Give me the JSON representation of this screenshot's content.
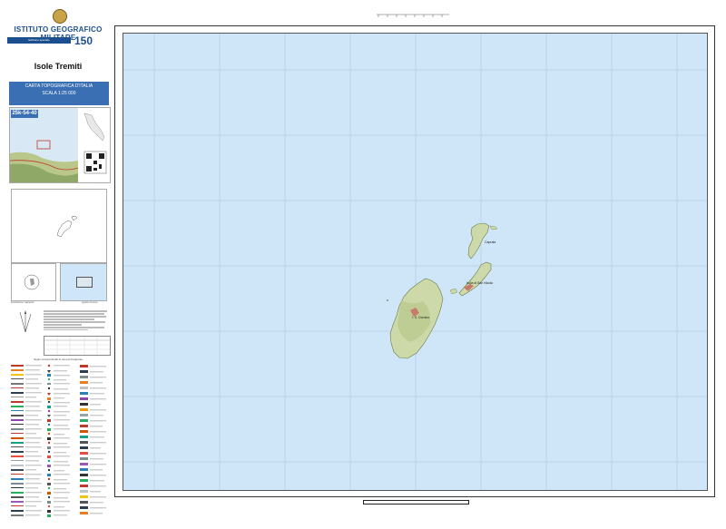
{
  "institute": {
    "name": "ISTITUTO GEOGRAFICO MILITARE",
    "edition_label": "Edizione speciale"
  },
  "sheet": {
    "title": "Isole Tremiti",
    "series_line1": "CARTA TOPOGRAFICA D'ITALIA",
    "series_line2": "SCALA 1:25 000",
    "id": "25k-54-40"
  },
  "map": {
    "places": [
      "Capraia",
      "Isola di San Nicola",
      "I. S. Domino"
    ]
  },
  "panels": {
    "magnetic_caption": "Declinazione magnetica",
    "index_caption": "Quadro d'unione",
    "legend_title": "Segni convenzionali di uso più frequente"
  },
  "colors": {
    "sea": "#cfe5f8",
    "accent": "#3a6fb3",
    "land": "#cdd9a8"
  }
}
